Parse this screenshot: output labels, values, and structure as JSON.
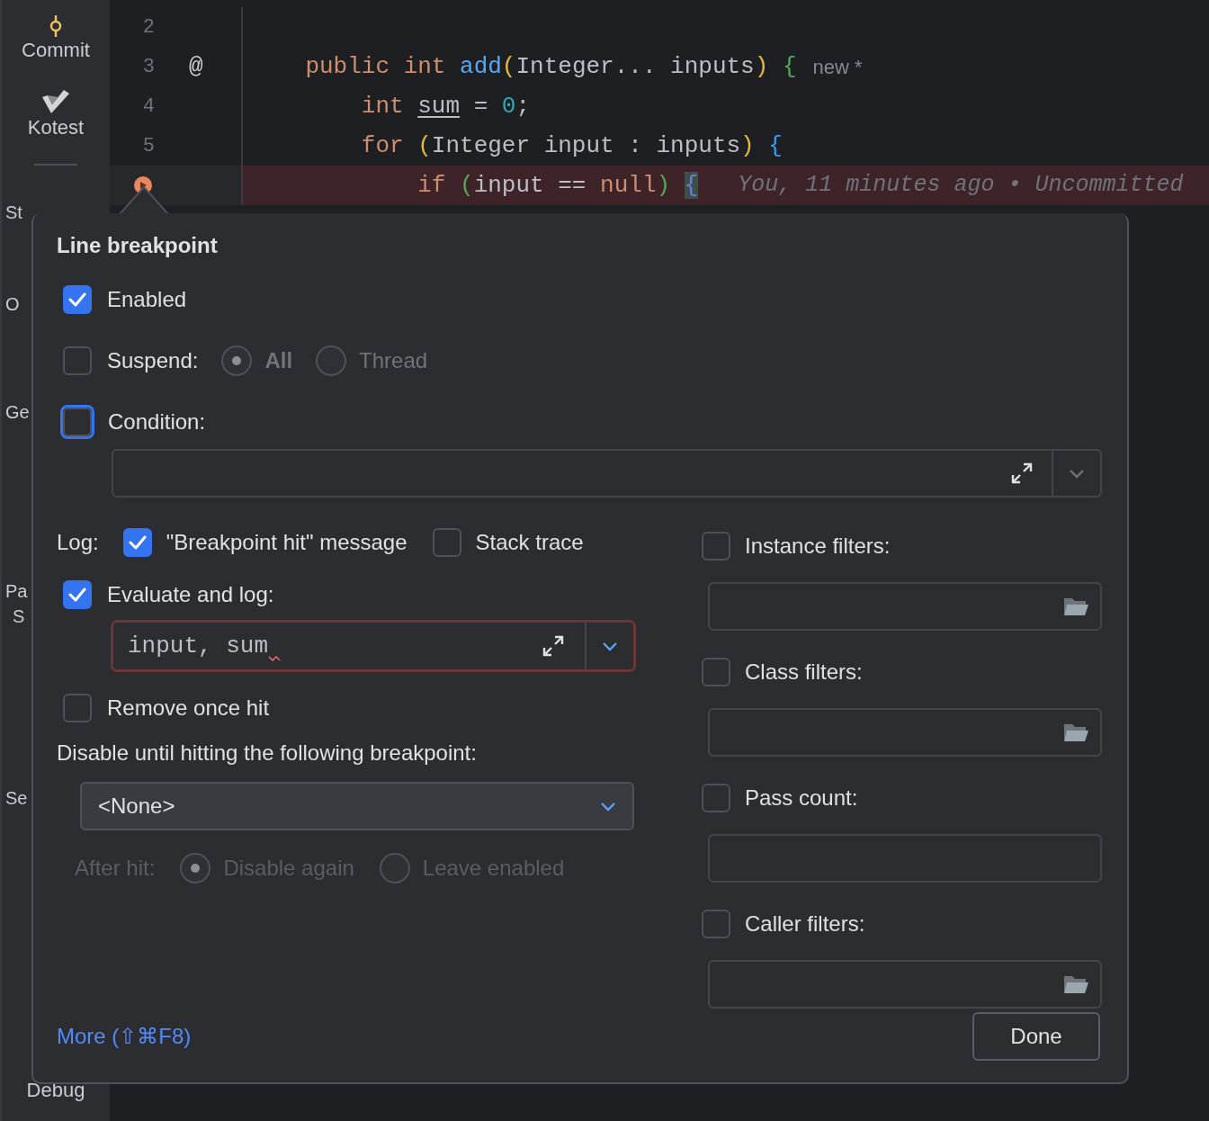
{
  "sidebar": {
    "items": [
      {
        "label": "Commit",
        "kind": "commit"
      },
      {
        "label": "Kotest",
        "kind": "kotest"
      }
    ],
    "cut_labels": [
      "St",
      "O",
      "Ge",
      "Pa",
      "S",
      "Se"
    ],
    "bottom_label": "Debug"
  },
  "editor": {
    "lines": [
      {
        "number": "2"
      },
      {
        "number": "3",
        "gutter_mark": "@",
        "tokens": [
          {
            "text": "    public int ",
            "kind": "keyword"
          },
          {
            "text": "add",
            "kind": "function"
          },
          {
            "text": "(",
            "kind": "paren1"
          },
          {
            "text": "Integer... inputs",
            "kind": "plain"
          },
          {
            "text": ") ",
            "kind": "paren1"
          },
          {
            "text": "{",
            "kind": "paren2"
          }
        ],
        "hint": "new *"
      },
      {
        "number": "4",
        "tokens": [
          {
            "text": "        int ",
            "kind": "keyword"
          },
          {
            "text": "sum",
            "kind": "var"
          },
          {
            "text": " = ",
            "kind": "plain"
          },
          {
            "text": "0",
            "kind": "number"
          },
          {
            "text": ";",
            "kind": "plain"
          }
        ]
      },
      {
        "number": "5",
        "tokens": [
          {
            "text": "        for ",
            "kind": "keyword"
          },
          {
            "text": "(",
            "kind": "paren1"
          },
          {
            "text": "Integer input : inputs",
            "kind": "plain"
          },
          {
            "text": ") ",
            "kind": "paren1"
          },
          {
            "text": "{",
            "kind": "paren3"
          }
        ]
      },
      {
        "breakpoint": true,
        "highlighted": true,
        "tokens": [
          {
            "text": "            if ",
            "kind": "keyword"
          },
          {
            "text": "(",
            "kind": "paren2"
          },
          {
            "text": "input == ",
            "kind": "plain"
          },
          {
            "text": "null",
            "kind": "keyword"
          },
          {
            "text": ") ",
            "kind": "paren2"
          },
          {
            "text": "{",
            "kind": "paren4"
          }
        ],
        "blame": "You, 11 minutes ago • Uncommitted"
      }
    ]
  },
  "popup": {
    "title": "Line breakpoint",
    "enabled": {
      "label": "Enabled",
      "checked": true
    },
    "suspend": {
      "label": "Suspend:",
      "checked": false,
      "options": [
        {
          "label": "All",
          "selected": true
        },
        {
          "label": "Thread",
          "selected": false
        }
      ]
    },
    "condition": {
      "label": "Condition:",
      "checked": false,
      "focused": true
    },
    "log": {
      "label": "Log:",
      "options": [
        {
          "label": "\"Breakpoint hit\" message",
          "checked": true
        },
        {
          "label": "Stack trace",
          "checked": false
        }
      ]
    },
    "evaluate": {
      "label": "Evaluate and log:",
      "checked": true,
      "value": "input, sum",
      "error": true
    },
    "remove_once_hit": {
      "label": "Remove once hit",
      "checked": false
    },
    "disable_until": {
      "label": "Disable until hitting the following breakpoint:",
      "value": "<None>"
    },
    "after_hit": {
      "label": "After hit:",
      "disabled": true,
      "options": [
        {
          "label": "Disable again",
          "selected": true
        },
        {
          "label": "Leave enabled",
          "selected": false
        }
      ]
    },
    "filters": [
      {
        "label": "Instance filters:",
        "checked": false,
        "kind": "browse"
      },
      {
        "label": "Class filters:",
        "checked": false,
        "kind": "browse"
      },
      {
        "label": "Pass count:",
        "checked": false,
        "kind": "plain"
      },
      {
        "label": "Caller filters:",
        "checked": false,
        "kind": "browse"
      }
    ],
    "more_link": "More (⇧⌘F8)",
    "done": "Done"
  }
}
